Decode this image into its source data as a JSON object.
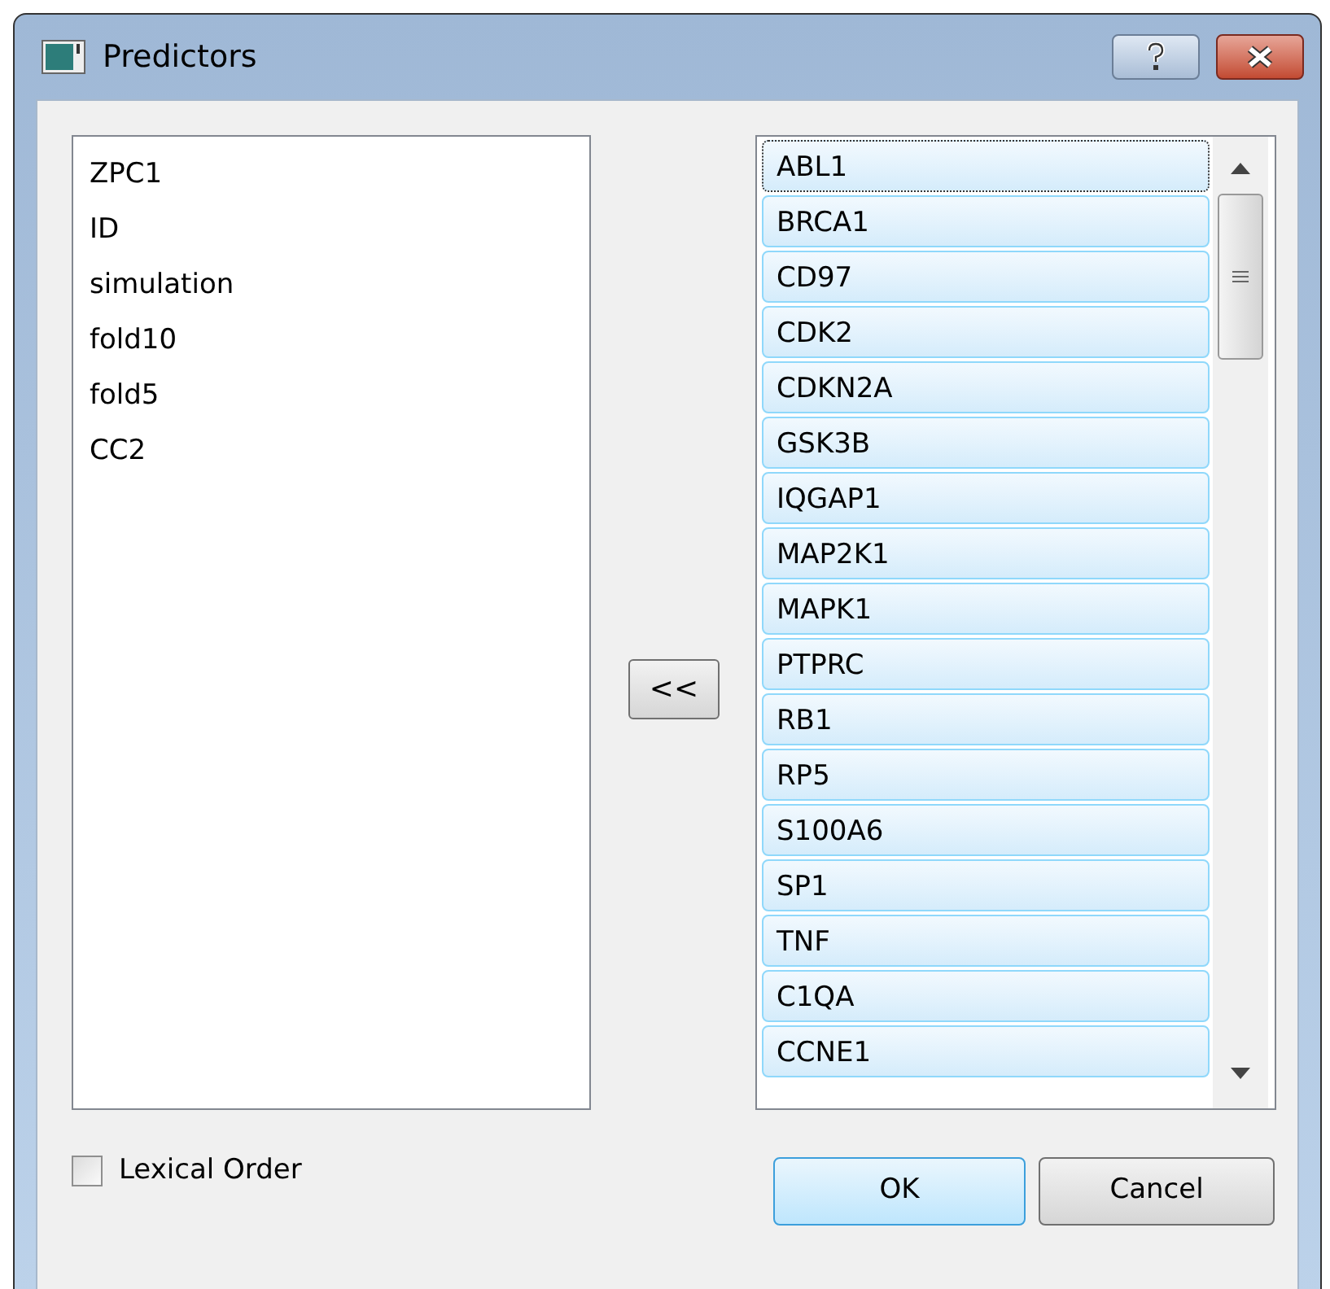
{
  "window": {
    "title": "Predictors"
  },
  "available": {
    "items": [
      {
        "label": "ZPC1"
      },
      {
        "label": "ID"
      },
      {
        "label": "simulation"
      },
      {
        "label": "fold10"
      },
      {
        "label": "fold5"
      },
      {
        "label": "CC2"
      }
    ]
  },
  "move_button": {
    "label": "<<"
  },
  "chosen": {
    "items": [
      {
        "label": "ABL1",
        "selected": true,
        "focused": true
      },
      {
        "label": "BRCA1",
        "selected": true,
        "focused": false
      },
      {
        "label": "CD97",
        "selected": true,
        "focused": false
      },
      {
        "label": "CDK2",
        "selected": true,
        "focused": false
      },
      {
        "label": "CDKN2A",
        "selected": true,
        "focused": false
      },
      {
        "label": "GSK3B",
        "selected": true,
        "focused": false
      },
      {
        "label": "IQGAP1",
        "selected": true,
        "focused": false
      },
      {
        "label": "MAP2K1",
        "selected": true,
        "focused": false
      },
      {
        "label": "MAPK1",
        "selected": true,
        "focused": false
      },
      {
        "label": "PTPRC",
        "selected": true,
        "focused": false
      },
      {
        "label": "RB1",
        "selected": true,
        "focused": false
      },
      {
        "label": "RP5",
        "selected": true,
        "focused": false
      },
      {
        "label": "S100A6",
        "selected": true,
        "focused": false
      },
      {
        "label": "SP1",
        "selected": true,
        "focused": false
      },
      {
        "label": "TNF",
        "selected": true,
        "focused": false
      },
      {
        "label": "C1QA",
        "selected": true,
        "focused": false
      },
      {
        "label": "CCNE1",
        "selected": true,
        "focused": false
      }
    ]
  },
  "lexical_order": {
    "label": "Lexical Order",
    "checked": false
  },
  "buttons": [
    {
      "label": "OK",
      "kind": "default"
    },
    {
      "label": "Cancel",
      "kind": "normal"
    }
  ]
}
